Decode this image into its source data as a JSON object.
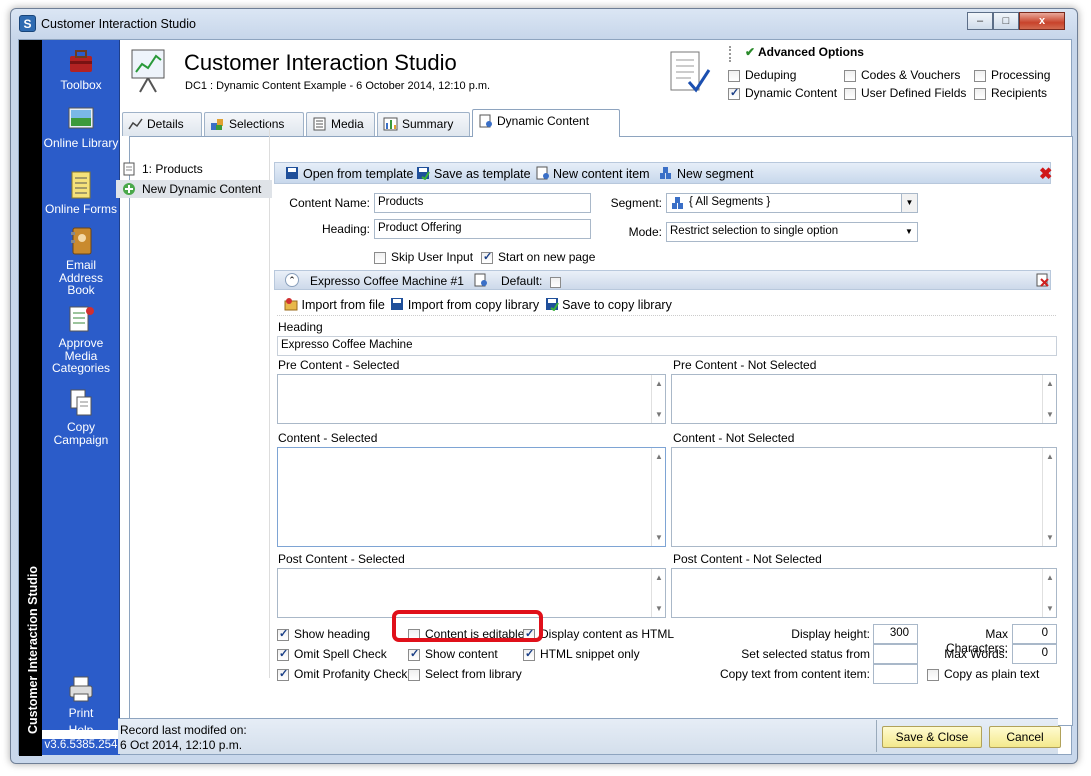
{
  "window": {
    "title": "Customer Interaction Studio",
    "min": "–",
    "max": "□",
    "close": "x"
  },
  "sidebar": {
    "vertical_title": "Customer Interaction Studio",
    "items": [
      {
        "label": "Toolbox",
        "icon": "toolbox-icon"
      },
      {
        "label": "Online Library",
        "icon": "online-library-icon"
      },
      {
        "label": "Online Forms",
        "icon": "online-forms-icon"
      },
      {
        "label": "Email Address Book",
        "icon": "address-book-icon"
      },
      {
        "label": "Approve Media Categories",
        "icon": "approve-media-icon"
      },
      {
        "label": "Copy Campaign",
        "icon": "copy-campaign-icon"
      },
      {
        "label": "Print",
        "icon": "print-icon"
      },
      {
        "label": "Help",
        "icon": "help-icon"
      }
    ],
    "version": "v3.6.5385.254"
  },
  "header": {
    "title": "Customer Interaction Studio",
    "subtitle": "DC1 : Dynamic Content Example - 6 October 2014, 12:10 p.m."
  },
  "advanced": {
    "title": "Advanced Options",
    "options": [
      {
        "label": "Deduping",
        "checked": false
      },
      {
        "label": "Codes & Vouchers",
        "checked": false
      },
      {
        "label": "Processing",
        "checked": false
      },
      {
        "label": "Dynamic Content",
        "checked": true
      },
      {
        "label": "User Defined Fields",
        "checked": false
      },
      {
        "label": "Recipients",
        "checked": false
      }
    ]
  },
  "tabs": [
    {
      "label": "Details"
    },
    {
      "label": "Selections"
    },
    {
      "label": "Media"
    },
    {
      "label": "Summary"
    },
    {
      "label": "Dynamic Content",
      "active": true
    }
  ],
  "tree": {
    "item1": "1: Products",
    "item2": "New Dynamic Content"
  },
  "toolbar": {
    "open_template": "Open from template",
    "save_template": "Save as template",
    "new_item": "New content item",
    "new_segment": "New segment"
  },
  "form": {
    "content_name_label": "Content Name:",
    "content_name": "Products",
    "heading_label": "Heading:",
    "heading": "Product Offering",
    "segment_label": "Segment:",
    "segment": "{ All Segments }",
    "mode_label": "Mode:",
    "mode": "Restrict selection to single option",
    "skip_user_input": "Skip User Input",
    "start_new_page": "Start on new page"
  },
  "item": {
    "title": "Expresso Coffee Machine #1",
    "default_label": "Default:",
    "import_file": "Import from file",
    "import_copy": "Import from copy library",
    "save_copy": "Save to copy library",
    "heading_label": "Heading",
    "heading_value": "Expresso Coffee Machine",
    "pre_sel": "Pre Content - Selected",
    "pre_notsel": "Pre Content - Not Selected",
    "content_sel": "Content - Selected",
    "content_notsel": "Content - Not Selected",
    "post_sel": "Post Content - Selected",
    "post_notsel": "Post Content - Not Selected"
  },
  "options": {
    "show_heading": "Show heading",
    "omit_spell": "Omit Spell Check",
    "omit_profanity": "Omit Profanity Check",
    "content_editable": "Content is editable",
    "show_content": "Show content",
    "select_library": "Select from library",
    "display_html": "Display content as HTML",
    "html_snippet": "HTML snippet only",
    "display_height_label": "Display height:",
    "display_height": "300",
    "set_status_label": "Set selected status from",
    "copy_text_label": "Copy text from content item:",
    "max_chars_label": "Max Characters:",
    "max_chars": "0",
    "max_words_label": "Max Words:",
    "max_words": "0",
    "copy_plain": "Copy as plain text"
  },
  "footer": {
    "record_label": "Record last modifed on:",
    "record_date": "6 Oct 2014, 12:10 p.m.",
    "save_close": "Save & Close",
    "cancel": "Cancel"
  },
  "colors": {
    "accent": "#2b5cc9",
    "highlight": "#e0101a"
  }
}
